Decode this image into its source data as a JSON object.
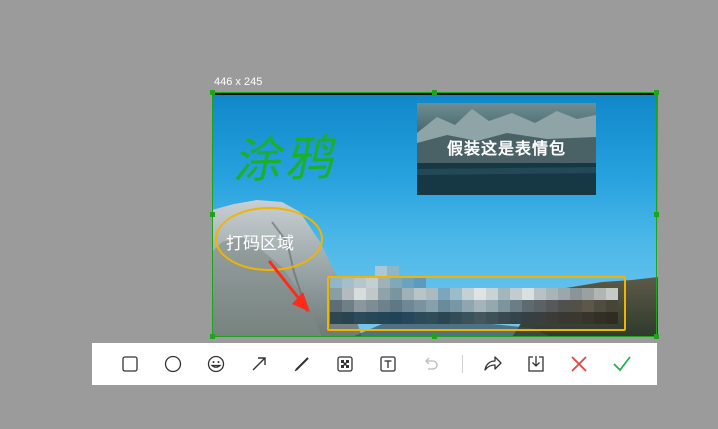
{
  "selection": {
    "size_label": "446 x 245"
  },
  "annotations": {
    "scribble_text": "涂鸦",
    "meme_text": "假装这是表情包",
    "mosaic_label": "打码区域"
  },
  "colors": {
    "selection_border": "#1fa31f",
    "highlight": "#f1b400",
    "arrow": "#ff2a1a",
    "scribble": "#1bb02a",
    "cancel": "#e8403a",
    "confirm": "#22b14c"
  },
  "toolbar": {
    "tools": [
      {
        "name": "rectangle-icon"
      },
      {
        "name": "ellipse-icon"
      },
      {
        "name": "emoji-icon"
      },
      {
        "name": "arrow-icon"
      },
      {
        "name": "pen-icon"
      },
      {
        "name": "mosaic-icon"
      },
      {
        "name": "text-icon"
      },
      {
        "name": "undo-icon"
      },
      {
        "name": "share-icon"
      },
      {
        "name": "save-icon"
      },
      {
        "name": "cancel-icon"
      },
      {
        "name": "confirm-icon"
      }
    ]
  }
}
